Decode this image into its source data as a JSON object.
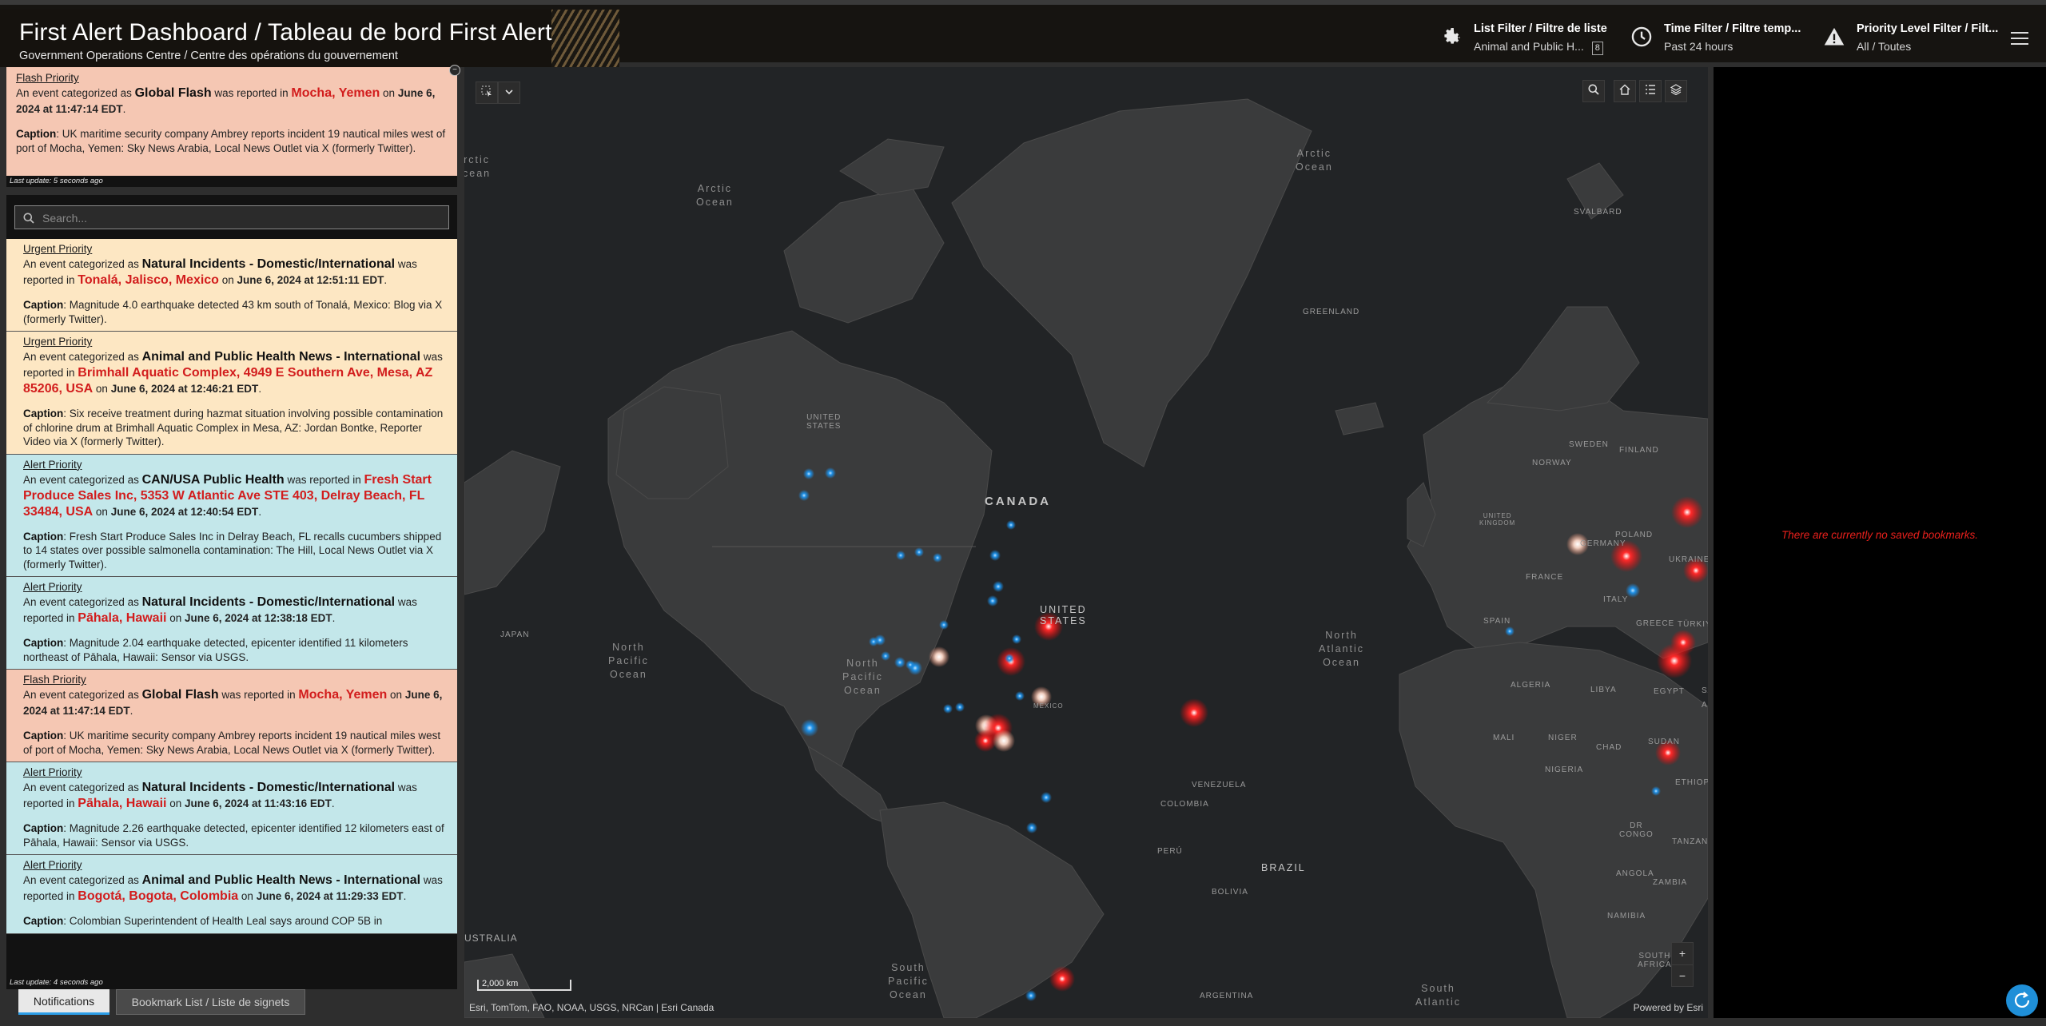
{
  "header": {
    "title": "First Alert Dashboard / Tableau de bord First Alert",
    "subtitle": "Government Operations Centre / Centre des opérations du gouvernement",
    "filters": [
      {
        "label": "List Filter / Filtre de liste",
        "value": "Animal and Public H...",
        "count": "8",
        "icon": "gear-icon"
      },
      {
        "label": "Time Filter / Filtre temp...",
        "value": "Past 24 hours",
        "icon": "clock-icon"
      },
      {
        "label": "Priority Level Filter / Filt...",
        "value": "All / Toutes",
        "icon": "warning-icon"
      }
    ]
  },
  "flash": {
    "priority": "Flash Priority",
    "pre": "An event categorized as ",
    "category": "Global Flash",
    "mid": " was reported in ",
    "location": "Mocha, Yemen",
    "on": " on ",
    "when": "June 6, 2024 at 11:47:14 EDT",
    "end": ".",
    "caption_label": "Caption",
    "caption": ": UK maritime security company Ambrey reports incident 19 nautical miles west of port of Mocha, Yemen: Sky News Arabia, Local News Outlet via X (formerly Twitter).",
    "last_update": "Last update: 5 seconds ago"
  },
  "feed": {
    "search_placeholder": "Search...",
    "last_update": "Last update: 4 seconds ago",
    "cards": [
      {
        "type": "urgent",
        "priority": "Urgent Priority",
        "category": "Natural Incidents - Domestic/International",
        "location": "Tonalá, Jalisco, Mexico",
        "when": "June 6, 2024 at 12:51:11 EDT",
        "caption": ": Magnitude 4.0 earthquake detected 43 km south of Tonalá, Mexico: Blog via X (formerly Twitter)."
      },
      {
        "type": "urgent",
        "priority": "Urgent Priority",
        "category": "Animal and Public Health News - International",
        "location": "Brimhall Aquatic Complex, 4949 E Southern Ave, Mesa, AZ 85206, USA",
        "when": "June 6, 2024 at 12:46:21 EDT",
        "caption": ": Six receive treatment during hazmat situation involving possible contamination of chlorine drum at Brimhall Aquatic Complex in Mesa, AZ: Jordan Bontke, Reporter Video via X (formerly Twitter)."
      },
      {
        "type": "alert",
        "priority": "Alert Priority",
        "category": "CAN/USA Public Health",
        "location": "Fresh Start Produce Sales Inc, 5353 W Atlantic Ave STE 403, Delray Beach, FL 33484, USA",
        "when": "June 6, 2024 at 12:40:54 EDT",
        "caption": ": Fresh Start Produce Sales Inc in Delray Beach, FL recalls cucumbers shipped to 14 states over possible salmonella contamination: The Hill, Local News Outlet via X (formerly Twitter)."
      },
      {
        "type": "alert",
        "priority": "Alert Priority",
        "category": "Natural Incidents - Domestic/International",
        "location": "Pāhala, Hawaii",
        "when": "June 6, 2024 at 12:38:18 EDT",
        "caption": ": Magnitude 2.04 earthquake detected, epicenter identified 11 kilometers northeast of Pāhala, Hawaii: Sensor via USGS."
      },
      {
        "type": "flash",
        "priority": "Flash Priority",
        "category": "Global Flash",
        "location": "Mocha, Yemen",
        "when": "June 6, 2024 at 11:47:14 EDT",
        "caption": ": UK maritime security company Ambrey reports incident 19 nautical miles west of port of Mocha, Yemen: Sky News Arabia, Local News Outlet via X (formerly Twitter)."
      },
      {
        "type": "alert",
        "priority": "Alert Priority",
        "category": "Natural Incidents - Domestic/International",
        "location": "Pāhala, Hawaii",
        "when": "June 6, 2024 at 11:43:16 EDT",
        "caption": ": Magnitude 2.26 earthquake detected, epicenter identified 12 kilometers east of Pāhala, Hawaii: Sensor via USGS."
      },
      {
        "type": "alert",
        "priority": "Alert Priority",
        "category": "Animal and Public Health News - International",
        "location": "Bogotá, Bogota, Colombia",
        "when": "June 6, 2024 at 11:29:33 EDT",
        "caption": ": Colombian Superintendent of Health Leal says around COP 5B in"
      }
    ],
    "text": {
      "pre": "An event categorized as ",
      "mid": " was reported in ",
      "on": " on ",
      "end": ".",
      "caption_label": "Caption"
    }
  },
  "tabs": {
    "notifications": "Notifications",
    "bookmarks": "Bookmark List / Liste de signets"
  },
  "map": {
    "labels": {
      "arctic_ocean": [
        "Arctic",
        "Ocean"
      ],
      "arctic_ocean_left": [
        "rctic",
        "cean"
      ],
      "canada": "CANADA",
      "united_states": [
        "UNITED",
        "STATES"
      ],
      "united_states_ak": [
        "UNITED",
        "STATES"
      ],
      "greenland": "GREENLAND",
      "svalbard": "SVALBARD",
      "norway": "NORWAY",
      "sweden": "SWEDEN",
      "finland": "FINLAND",
      "united_kingdom": [
        "UNITED",
        "KINGDOM"
      ],
      "germany": "GERMANY",
      "poland": "POLAND",
      "ukraine": "UKRAINE",
      "france": "FRANCE",
      "italy": "ITALY",
      "spain": "SPAIN",
      "greece": "GREECE",
      "turkiye": "TÜRKIYE",
      "algeria": "ALGERIA",
      "libya": "LIBYA",
      "egypt": "EGYPT",
      "mali": "MALI",
      "niger": "NIGER",
      "chad": "CHAD",
      "sudan": "SUDAN",
      "nigeria": "NIGERIA",
      "ethiop": "ETHIOP",
      "dr_congo": [
        "DR",
        "CONGO"
      ],
      "tanzania": "TANZANIA",
      "angola": "ANGOLA",
      "zambia": "ZAMBIA",
      "namibia": "NAMIBIA",
      "south_africa": [
        "SOUTH",
        "AFRICA"
      ],
      "japan": "JAPAN",
      "mexico": "MEXICO",
      "venezuela": "VENEZUELA",
      "colombia": "COLOMBIA",
      "peru": "PERÚ",
      "bolivia": "BOLIVIA",
      "brazil": "BRAZIL",
      "argentina": "ARGENTINA",
      "australia": "USTRALIA",
      "north_pacific_left": [
        "North",
        "Pacific",
        "Ocean"
      ],
      "north_pacific_right": [
        "North",
        "Pacific",
        "Ocean"
      ],
      "north_atlantic": [
        "North",
        "Atlantic",
        "Ocean"
      ],
      "south_pacific": [
        "South",
        "Pacific",
        "Ocean"
      ],
      "south_atlantic": [
        "South",
        "Atlantic"
      ],
      "sa_fragment": "SA",
      "ar_fragment": "AR"
    },
    "scale": "2,000 km",
    "attribution": "Esri, TomTom, FAO, NOAA, USGS, NRCan | Esri Canada",
    "powered_by": "Powered by Esri",
    "zoom_in": "+",
    "zoom_out": "−"
  },
  "bookmarks": {
    "empty_message": "There are currently no saved bookmarks."
  },
  "colors": {
    "urgent": "#fde7c3",
    "alert": "#c3e7ea",
    "flash": "#f5c7b3",
    "location": "#d21d1d",
    "accent": "#1f8fd8"
  }
}
